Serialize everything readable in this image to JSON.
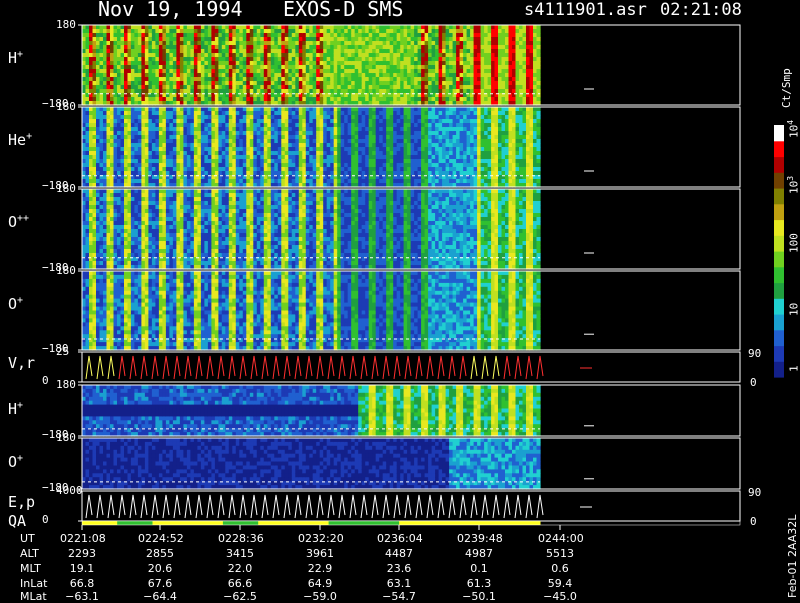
{
  "title": {
    "date": "Nov 19, 1994",
    "instrument": "EXOS-D SMS",
    "file": "s4111901.asr",
    "time": "02:21:08"
  },
  "chart_data": {
    "type": "heatmap",
    "colorbar": {
      "label": "Ct/Smp",
      "scale": "log",
      "range": [
        1,
        10000
      ],
      "ticks": [
        "1",
        "10",
        "100",
        "10",
        "10"
      ],
      "tick_powers": [
        "",
        "",
        "",
        "3",
        "4"
      ],
      "colors": [
        "#13208a",
        "#1d3ab5",
        "#2060d0",
        "#1aa0d0",
        "#20d0d0",
        "#20a040",
        "#30c030",
        "#70d020",
        "#c0e020",
        "#e8e820",
        "#c0a010",
        "#808000",
        "#704000",
        "#b00000",
        "#ff0000",
        "#ffffff"
      ]
    },
    "panels": [
      {
        "species": "H",
        "charge": "+",
        "ytick_top": "180",
        "ytick_bottom": "−180",
        "style": "hstrong"
      },
      {
        "species": "He",
        "charge": "+",
        "ytick_top": "180",
        "ytick_bottom": "−180",
        "style": "heavy"
      },
      {
        "species": "O",
        "charge": "++",
        "ytick_top": "180",
        "ytick_bottom": "−180",
        "style": "heavy"
      },
      {
        "species": "O",
        "charge": "+",
        "ytick_top": "180",
        "ytick_bottom": "−180",
        "style": "heavy"
      },
      {
        "species": "V,r",
        "charge": "",
        "ytick_top": "25",
        "ytick_bottom": "0",
        "right_top": "90",
        "right_bottom": "0",
        "style": "line"
      },
      {
        "species": "H",
        "charge": "+",
        "ytick_top": "180",
        "ytick_bottom": "−180",
        "style": "hlow"
      },
      {
        "species": "O",
        "charge": "+",
        "ytick_top": "180",
        "ytick_bottom": "−180",
        "style": "olow"
      },
      {
        "species": "E,p",
        "charge": "",
        "ytick_top": "4000",
        "ytick_bottom": "0",
        "right_top": "90",
        "right_bottom": "0",
        "style": "line"
      }
    ],
    "qa_label": "QA",
    "time_axis": {
      "rows": [
        {
          "label": "UT",
          "values": [
            "0221:08",
            "0224:52",
            "0228:36",
            "0232:20",
            "0236:04",
            "0239:48",
            "0244:00"
          ]
        },
        {
          "label": "ALT",
          "values": [
            "2293",
            "2855",
            "3415",
            "3961",
            "4487",
            "4987",
            "5513"
          ]
        },
        {
          "label": "MLT",
          "values": [
            "19.1",
            "20.6",
            "22.0",
            "22.9",
            "23.6",
            "0.1",
            "0.6"
          ]
        },
        {
          "label": "InLat",
          "values": [
            "66.8",
            "67.6",
            "66.6",
            "64.9",
            "63.1",
            "61.3",
            "59.4"
          ]
        },
        {
          "label": "MLat",
          "values": [
            "−63.1",
            "−64.4",
            "−62.5",
            "−59.0",
            "−54.7",
            "−50.1",
            "−45.0"
          ]
        }
      ]
    }
  },
  "footer_code": "Feb-01 2AA32L"
}
